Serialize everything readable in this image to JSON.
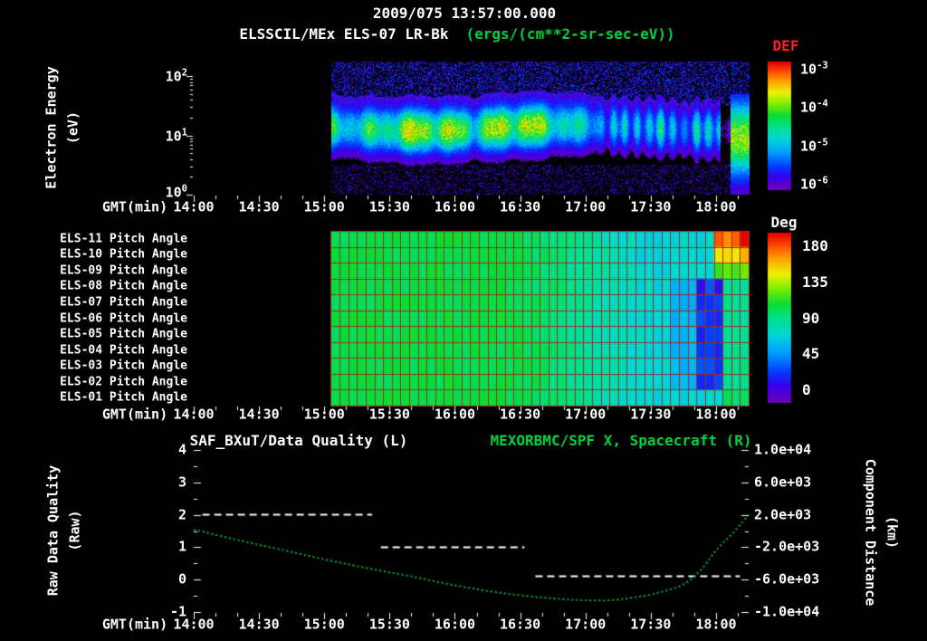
{
  "title": {
    "date_line": "2009/075 13:57:00.000",
    "instrument": "ELSSCIL/MEx ELS-07 LR-Bk",
    "units": "(ergs/(cm**2-sr-sec-eV))"
  },
  "colors": {
    "background": "#000000",
    "text_white": "#ffffff",
    "accent_green": "#00d23c",
    "accent_red": "#ff2020",
    "grid_red": "#963226",
    "curve_green": "#00b438"
  },
  "time_axis": {
    "label": "GMT(min)",
    "ticks": [
      "14:00",
      "14:30",
      "15:00",
      "15:30",
      "16:00",
      "16:30",
      "17:00",
      "17:30",
      "18:00"
    ],
    "start_min": 0,
    "end_min": 255,
    "major_tick_min": 30,
    "minor_tick_min": 10,
    "data_start_min": 63
  },
  "spectrogram_panel": {
    "y_axis_label": "Electron Energy",
    "y_axis_units": "(eV)",
    "y_ticks": [
      "10^2",
      "10^1",
      "10^0"
    ],
    "y_log_range": [
      0,
      2.25
    ],
    "colorbar": {
      "title": "DEF",
      "ticks": [
        "10^-3",
        "10^-4",
        "10^-5",
        "10^-6"
      ]
    }
  },
  "pitch_panel": {
    "row_labels": [
      "ELS-11 Pitch Angle",
      "ELS-10 Pitch Angle",
      "ELS-09 Pitch Angle",
      "ELS-08 Pitch Angle",
      "ELS-07 Pitch Angle",
      "ELS-06 Pitch Angle",
      "ELS-05 Pitch Angle",
      "ELS-04 Pitch Angle",
      "ELS-03 Pitch Angle",
      "ELS-02 Pitch Angle",
      "ELS-01 Pitch Angle"
    ],
    "colorbar": {
      "title": "Deg",
      "ticks": [
        "180",
        "135",
        "90",
        "45",
        "0"
      ]
    }
  },
  "bottom_panel": {
    "title_left": "SAF_BXuT/Data Quality (L)",
    "title_right": "MEXORBMC/SPF X, Spacecraft (R)",
    "left_axis": {
      "label": "Raw Data Quality",
      "units": "(Raw)",
      "ticks": [
        "4",
        "3",
        "2",
        "1",
        "0",
        "-1"
      ],
      "min": -1,
      "max": 4
    },
    "right_axis": {
      "label": "Component Distance",
      "units": "(km)",
      "ticks": [
        "1.0e+04",
        "6.0e+03",
        "2.0e+03",
        "-2.0e+03",
        "-6.0e+03",
        "-1.0e+04"
      ],
      "min": -10000,
      "max": 10000
    }
  },
  "chart_data": [
    {
      "type": "heatmap",
      "title": "ELSSCIL/MEx ELS-07 LR-Bk electron energy spectrogram",
      "xlabel": "GMT(min)",
      "ylabel": "Electron Energy (eV)",
      "x_range_min": [
        0,
        255
      ],
      "x_tick_labels": [
        "14:00",
        "14:30",
        "15:00",
        "15:30",
        "16:00",
        "16:30",
        "17:00",
        "17:30",
        "18:00"
      ],
      "y_scale": "log",
      "y_range_ev": [
        1,
        180
      ],
      "value_units": "ergs/(cm**2-sr-sec-eV)",
      "value_scale": "log",
      "value_range": [
        1e-06,
        0.001
      ],
      "legend_position": "right",
      "features": {
        "no_data_before_min": 63,
        "intense_band_center_ev": 14,
        "intense_band_range_ev": [
          6,
          40
        ],
        "band_peak_flux": 0.0001,
        "background_flux": 1e-06,
        "weakened_interval_min": [
          190,
          242
        ],
        "dropout_interval_min": [
          242,
          246
        ],
        "broadband_burst_interval_min": [
          246,
          255
        ]
      }
    },
    {
      "type": "heatmap",
      "title": "ELS anode pitch angles",
      "rows": [
        "ELS-11",
        "ELS-10",
        "ELS-09",
        "ELS-08",
        "ELS-07",
        "ELS-06",
        "ELS-05",
        "ELS-04",
        "ELS-03",
        "ELS-02",
        "ELS-01"
      ],
      "value_units": "deg",
      "value_range": [
        0,
        180
      ],
      "x_range_min": [
        0,
        255
      ],
      "no_data_before_min": 63,
      "features": {
        "typical_deg_before_1630": 100,
        "typical_deg_after_1700": 72,
        "cyan_dip_interval_min": [
          218,
          233
        ],
        "low_deg_column_interval_min": [
          233,
          245
        ],
        "low_deg_column_value": 25,
        "low_deg_column_rows": [
          "ELS-08",
          "ELS-07",
          "ELS-06",
          "ELS-05",
          "ELS-04",
          "ELS-03",
          "ELS-02"
        ],
        "high_deg_end_rows": {
          "ELS-11": 170,
          "ELS-10": 148,
          "ELS-09": 118
        }
      }
    },
    {
      "type": "line",
      "title": "SAF_BXuT/Data Quality (L) and MEXORBMC/SPF X, Spacecraft (R)",
      "xlabel": "GMT(min)",
      "left_ylabel": "Raw Data Quality (Raw)",
      "right_ylabel": "Component Distance (km)",
      "left_ylim": [
        -1,
        4
      ],
      "right_ylim": [
        -10000,
        10000
      ],
      "km_per_left_unit": 4000,
      "series": [
        {
          "name": "SAF_BXuT/Data Quality",
          "axis": "left",
          "style": "dashed",
          "color": "#ffffff",
          "segments": [
            {
              "t_min": [
                4,
                82
              ],
              "value": 2.0
            },
            {
              "t_min": [
                86,
                152
              ],
              "value": 1.0
            },
            {
              "t_min": [
                157,
                251
              ],
              "value": 0.1
            }
          ]
        },
        {
          "name": "MEXORBMC/SPF X Spacecraft",
          "axis": "right",
          "style": "dotted",
          "color": "#00b438",
          "t_min": [
            0,
            20,
            40,
            60,
            80,
            100,
            120,
            140,
            160,
            175,
            190,
            205,
            215,
            225,
            233,
            240,
            248,
            255
          ],
          "km": [
            200,
            -1100,
            -2300,
            -3500,
            -4600,
            -5600,
            -6700,
            -7600,
            -8200,
            -8500,
            -8560,
            -8100,
            -7500,
            -6600,
            -4800,
            -2400,
            -200,
            2000
          ]
        }
      ]
    }
  ]
}
